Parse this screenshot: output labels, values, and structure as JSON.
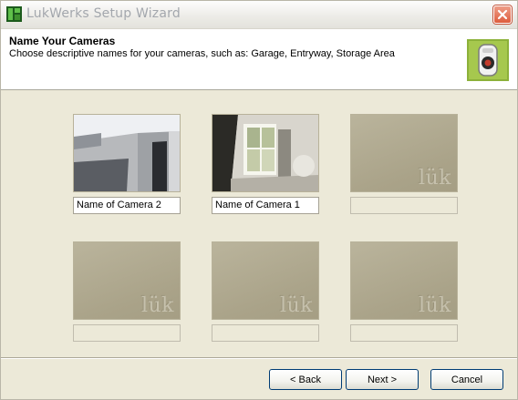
{
  "window": {
    "title": "LukWerks Setup Wizard",
    "app_icon": "lukwerks-app-icon",
    "close_icon": "close-icon"
  },
  "header": {
    "title": "Name Your Cameras",
    "subtitle": "Choose descriptive names for your cameras, such as:  Garage, Entryway, Storage Area",
    "icon": "camera-icon"
  },
  "cameras": [
    {
      "name": "Name of Camera 2",
      "preview": "camera-2-feed"
    },
    {
      "name": "Name of Camera 1",
      "preview": "camera-1-feed"
    },
    {
      "name": "",
      "placeholder": "lük"
    },
    {
      "name": "",
      "placeholder": "lük"
    },
    {
      "name": "",
      "placeholder": "lük"
    },
    {
      "name": "",
      "placeholder": "lük"
    }
  ],
  "buttons": {
    "back": "< Back",
    "next": "Next >",
    "cancel": "Cancel"
  },
  "colors": {
    "panel": "#ece9d8",
    "empty_slot": "#aaa389",
    "button_border": "#003c74"
  }
}
